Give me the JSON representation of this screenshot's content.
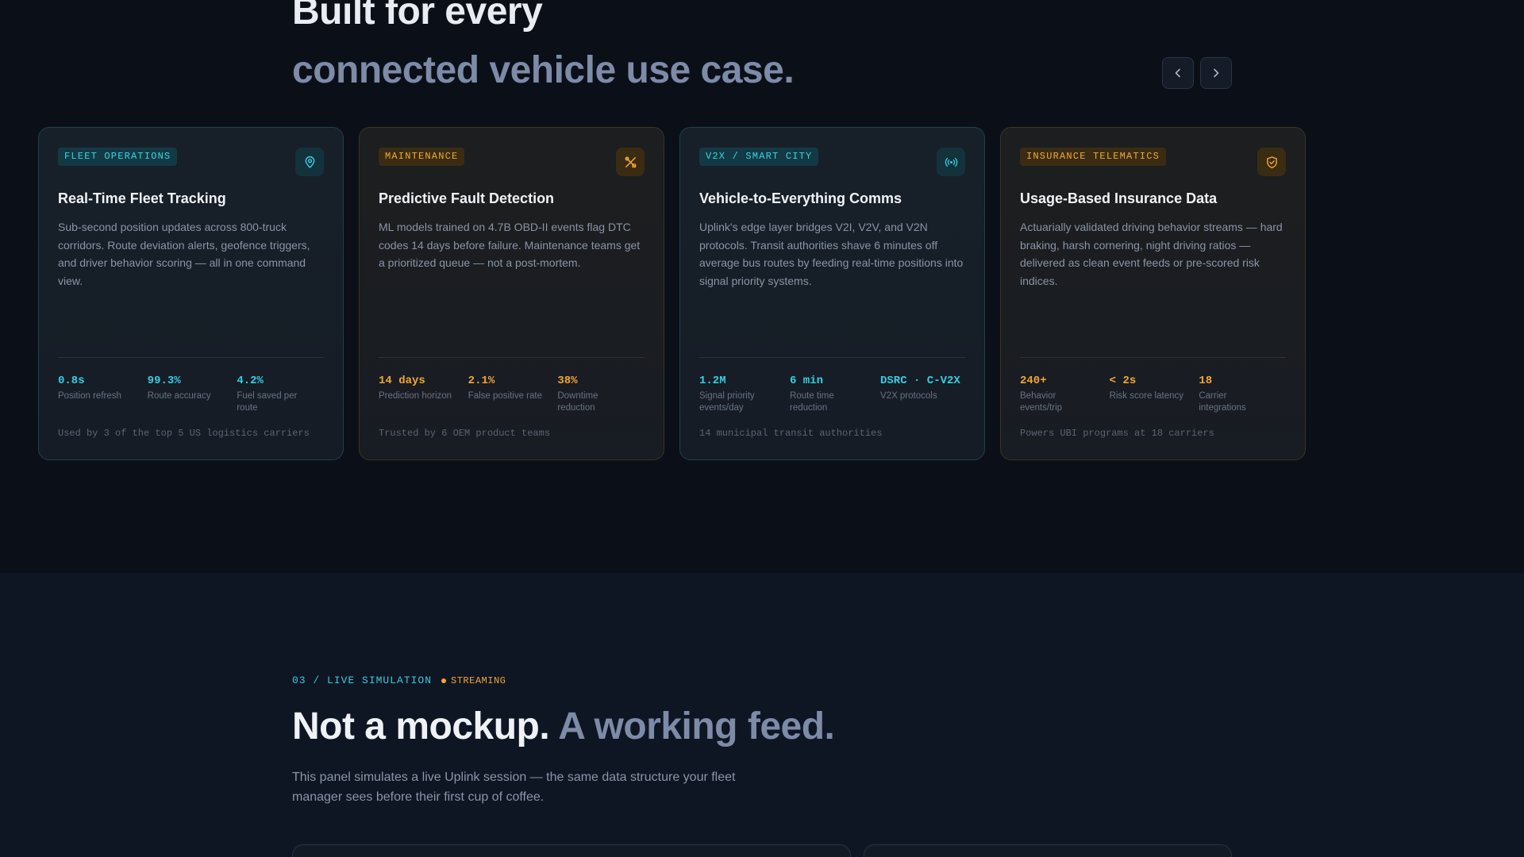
{
  "headline": {
    "line1": "Built for every",
    "line2": "connected vehicle use case."
  },
  "carousel": {
    "prev_icon": "chevron-left-icon",
    "next_icon": "chevron-right-icon"
  },
  "cards": [
    {
      "tag": "FLEET OPERATIONS",
      "icon": "map-pin-icon",
      "accent": "#36cde3",
      "title": "Real-Time Fleet Tracking",
      "desc": "Sub-second position updates across 800-truck corridors. Route deviation alerts, geofence triggers, and driver behavior scoring — all in one command view.",
      "stats": [
        {
          "value": "0.8s",
          "label": "Position refresh"
        },
        {
          "value": "99.3%",
          "label": "Route accuracy"
        },
        {
          "value": "4.2%",
          "label": "Fuel saved per route"
        }
      ],
      "footer": "Used by 3 of the top 5 US logistics carriers"
    },
    {
      "tag": "MAINTENANCE",
      "icon": "tools-icon",
      "accent": "#f2a534",
      "title": "Predictive Fault Detection",
      "desc": "ML models trained on 4.7B OBD-II events flag DTC codes 14 days before failure. Maintenance teams get a prioritized queue — not a post-mortem.",
      "stats": [
        {
          "value": "14 days",
          "label": "Prediction horizon"
        },
        {
          "value": "2.1%",
          "label": "False positive rate"
        },
        {
          "value": "38%",
          "label": "Downtime reduction"
        }
      ],
      "footer": "Trusted by 6 OEM product teams"
    },
    {
      "tag": "V2X / SMART CITY",
      "icon": "broadcast-icon",
      "accent": "#36cde3",
      "title": "Vehicle-to-Everything Comms",
      "desc": "Uplink's edge layer bridges V2I, V2V, and V2N protocols. Transit authorities shave 6 minutes off average bus routes by feeding real-time positions into signal priority systems.",
      "stats": [
        {
          "value": "1.2M",
          "label": "Signal priority events/day"
        },
        {
          "value": "6 min",
          "label": "Route time reduction"
        },
        {
          "value": "DSRC · C-V2X",
          "label": "V2X protocols"
        }
      ],
      "footer": "14 municipal transit authorities"
    },
    {
      "tag": "INSURANCE TELEMATICS",
      "icon": "shield-check-icon",
      "accent": "#f2a534",
      "title": "Usage-Based Insurance Data",
      "desc": "Actuarially validated driving behavior streams — hard braking, harsh cornering, night driving ratios — delivered as clean event feeds or pre-scored risk indices.",
      "stats": [
        {
          "value": "240+",
          "label": "Behavior events/trip"
        },
        {
          "value": "< 2s",
          "label": "Risk score latency"
        },
        {
          "value": "18",
          "label": "Carrier integrations"
        }
      ],
      "footer": "Powers UBI programs at 18 carriers"
    }
  ],
  "simulation": {
    "section_label": "03 / LIVE SIMULATION",
    "status": "STREAMING",
    "headline_a": "Not a mockup.",
    "headline_b": "A working feed.",
    "subtext": "This panel simulates a live Uplink session — the same data structure your fleet manager sees before their first cup of coffee."
  }
}
